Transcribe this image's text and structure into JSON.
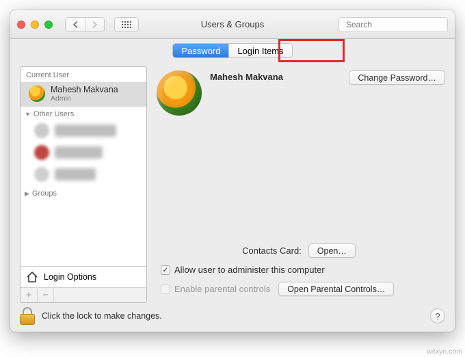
{
  "window_title": "Users & Groups",
  "search": {
    "placeholder": "Search"
  },
  "tabs": {
    "password": "Password",
    "login_items": "Login Items"
  },
  "sidebar": {
    "current_user_label": "Current User",
    "user": {
      "name": "Mahesh Makvana",
      "role": "Admin"
    },
    "other_users_label": "Other Users",
    "groups_label": "Groups",
    "login_options_label": "Login Options"
  },
  "detail": {
    "display_name": "Mahesh Makvana",
    "change_password_btn": "Change Password…",
    "contacts_card_label": "Contacts Card:",
    "open_btn": "Open…",
    "admin_checkbox_label": "Allow user to administer this computer",
    "parental_checkbox_label": "Enable parental controls",
    "parental_btn": "Open Parental Controls…"
  },
  "footer": {
    "lock_text": "Click the lock to make changes."
  },
  "watermark": "wsxyn.com"
}
